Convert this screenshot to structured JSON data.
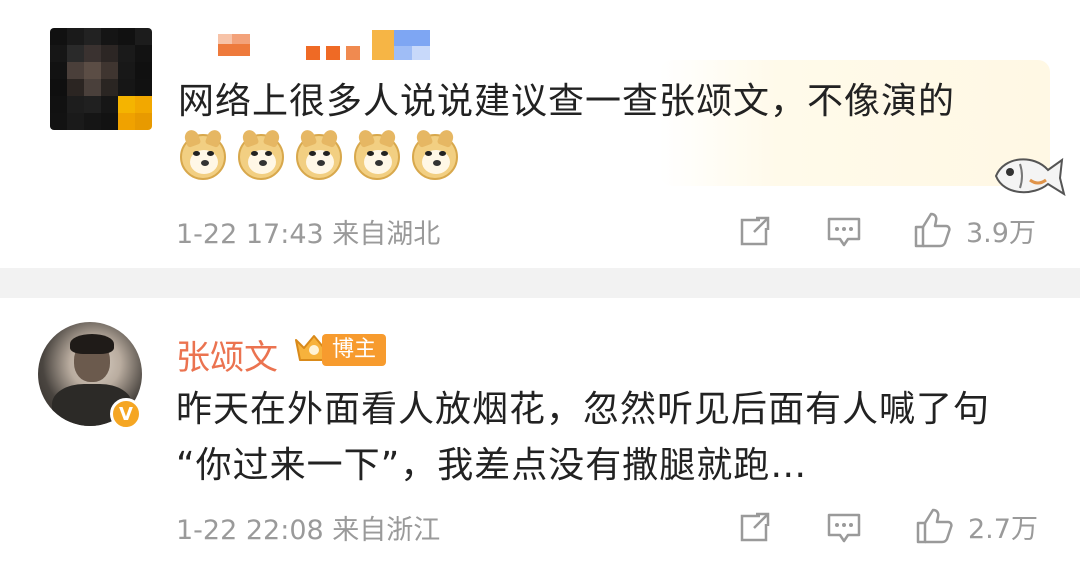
{
  "comments": [
    {
      "text": "网络上很多人说说建议查一查张颂文，不像演的",
      "emoji_icons": [
        "doge-emoji",
        "doge-emoji",
        "doge-emoji",
        "doge-emoji",
        "doge-emoji"
      ],
      "meta": "1-22 17:43 来自湖北",
      "like_count": "3.9万"
    },
    {
      "author": "张颂文",
      "badge": "博主",
      "text_lines": [
        "昨天在外面看人放烟花，忽然听见后面有人喊了句",
        "“你过来一下”，我差点没有撒腿就跑…"
      ],
      "meta": "1-22 22:08 来自浙江",
      "like_count": "2.7万"
    }
  ],
  "verified_badge": "V",
  "colors": {
    "name_accent": "#eb7350",
    "badge_bg": "#f79b2e",
    "meta_gray": "#9a9a9a",
    "divider": "#f2f2f2",
    "verified": "#f5a623"
  },
  "icons": {
    "share": "share-icon",
    "comment": "comment-icon",
    "like": "thumbs-up-icon"
  }
}
